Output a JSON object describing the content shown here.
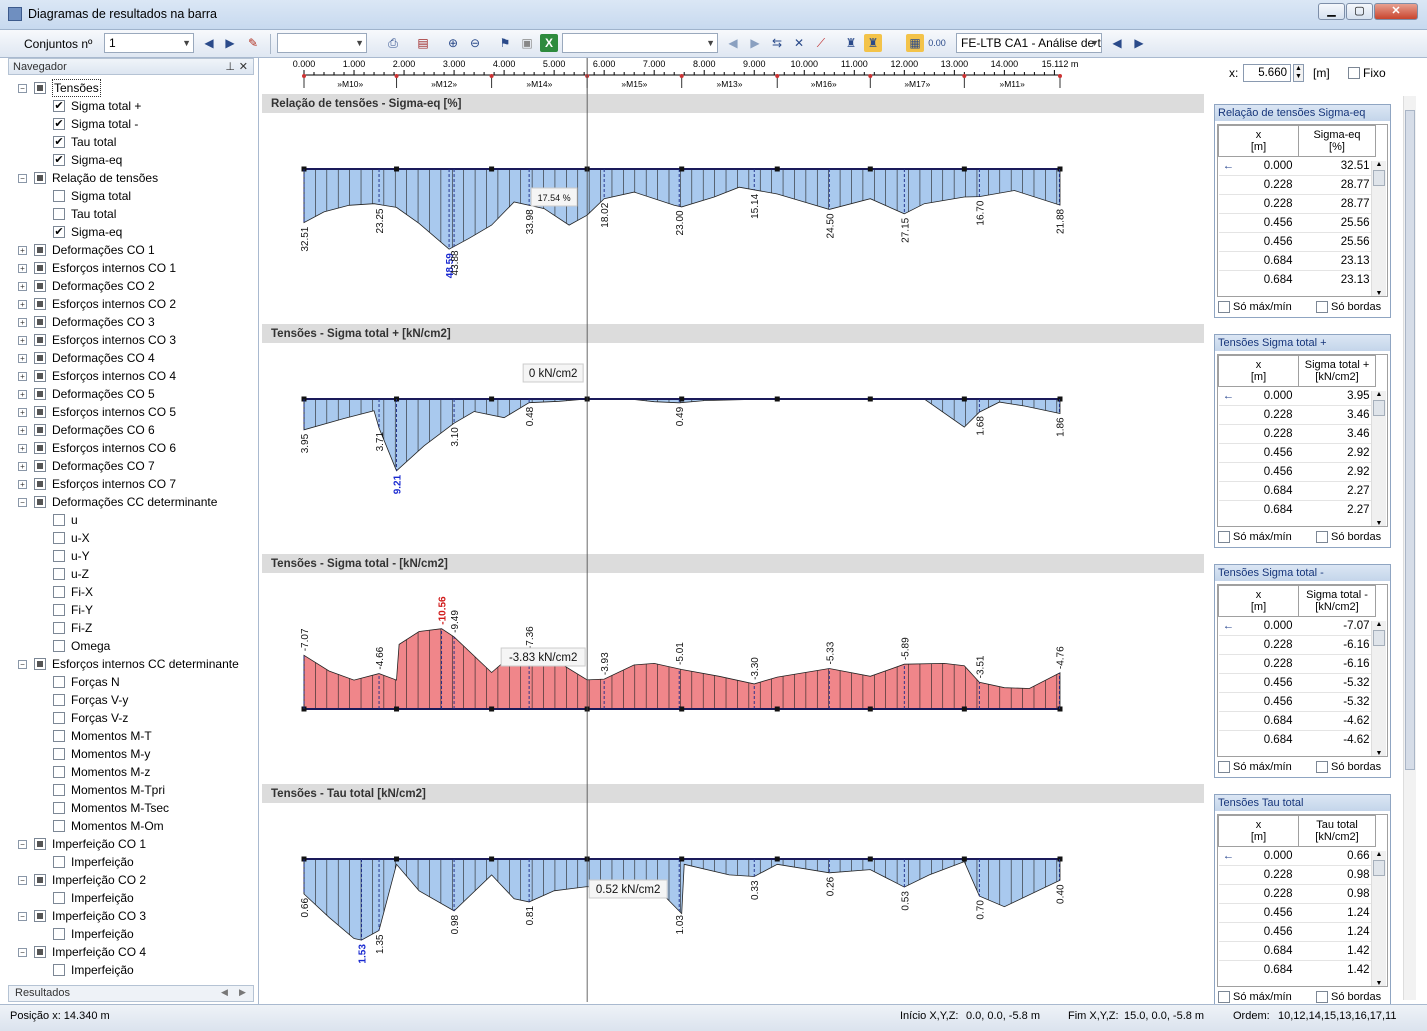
{
  "window": {
    "title": "Diagramas de resultados na barra"
  },
  "toolbar": {
    "conjuntos_label": "Conjuntos nº",
    "conjuntos_value": "1",
    "case_combo": "FE-LTB CA1 - Análise de t"
  },
  "navigator": {
    "title": "Navegador",
    "footer_tab": "Resultados",
    "items": [
      {
        "label": "Tensões",
        "level": 0,
        "exp": "-",
        "state": "part"
      },
      {
        "label": "Sigma total +",
        "level": 1,
        "state": "checked"
      },
      {
        "label": "Sigma total -",
        "level": 1,
        "state": "checked"
      },
      {
        "label": "Tau total",
        "level": 1,
        "state": "checked"
      },
      {
        "label": "Sigma-eq",
        "level": 1,
        "state": "checked"
      },
      {
        "label": "Relação de tensões",
        "level": 0,
        "exp": "-",
        "state": "part"
      },
      {
        "label": "Sigma total",
        "level": 1,
        "state": "empty"
      },
      {
        "label": "Tau total",
        "level": 1,
        "state": "empty"
      },
      {
        "label": "Sigma-eq",
        "level": 1,
        "state": "checked"
      },
      {
        "label": "Deformações CO 1",
        "level": 0,
        "exp": "+",
        "state": "part"
      },
      {
        "label": "Esforços internos CO 1",
        "level": 0,
        "exp": "+",
        "state": "part"
      },
      {
        "label": "Deformações CO 2",
        "level": 0,
        "exp": "+",
        "state": "part"
      },
      {
        "label": "Esforços internos CO 2",
        "level": 0,
        "exp": "+",
        "state": "part"
      },
      {
        "label": "Deformações CO 3",
        "level": 0,
        "exp": "+",
        "state": "part"
      },
      {
        "label": "Esforços internos CO 3",
        "level": 0,
        "exp": "+",
        "state": "part"
      },
      {
        "label": "Deformações CO 4",
        "level": 0,
        "exp": "+",
        "state": "part"
      },
      {
        "label": "Esforços internos CO 4",
        "level": 0,
        "exp": "+",
        "state": "part"
      },
      {
        "label": "Deformações CO 5",
        "level": 0,
        "exp": "+",
        "state": "part"
      },
      {
        "label": "Esforços internos CO 5",
        "level": 0,
        "exp": "+",
        "state": "part"
      },
      {
        "label": "Deformações CO 6",
        "level": 0,
        "exp": "+",
        "state": "part"
      },
      {
        "label": "Esforços internos CO 6",
        "level": 0,
        "exp": "+",
        "state": "part"
      },
      {
        "label": "Deformações CO 7",
        "level": 0,
        "exp": "+",
        "state": "part"
      },
      {
        "label": "Esforços internos CO 7",
        "level": 0,
        "exp": "+",
        "state": "part"
      },
      {
        "label": "Deformações CC determinante",
        "level": 0,
        "exp": "-",
        "state": "part"
      },
      {
        "label": "u",
        "level": 1,
        "state": "empty"
      },
      {
        "label": "u-X",
        "level": 1,
        "state": "empty"
      },
      {
        "label": "u-Y",
        "level": 1,
        "state": "empty"
      },
      {
        "label": "u-Z",
        "level": 1,
        "state": "empty"
      },
      {
        "label": "Fi-X",
        "level": 1,
        "state": "empty"
      },
      {
        "label": "Fi-Y",
        "level": 1,
        "state": "empty"
      },
      {
        "label": "Fi-Z",
        "level": 1,
        "state": "empty"
      },
      {
        "label": "Omega",
        "level": 1,
        "state": "empty"
      },
      {
        "label": "Esforços internos CC determinante",
        "level": 0,
        "exp": "-",
        "state": "part"
      },
      {
        "label": "Forças N",
        "level": 1,
        "state": "empty"
      },
      {
        "label": "Forças V-y",
        "level": 1,
        "state": "empty"
      },
      {
        "label": "Forças V-z",
        "level": 1,
        "state": "empty"
      },
      {
        "label": "Momentos M-T",
        "level": 1,
        "state": "empty"
      },
      {
        "label": "Momentos M-y",
        "level": 1,
        "state": "empty"
      },
      {
        "label": "Momentos M-z",
        "level": 1,
        "state": "empty"
      },
      {
        "label": "Momentos M-Tpri",
        "level": 1,
        "state": "empty"
      },
      {
        "label": "Momentos M-Tsec",
        "level": 1,
        "state": "empty"
      },
      {
        "label": "Momentos M-Om",
        "level": 1,
        "state": "empty"
      },
      {
        "label": "Imperfeição CO 1",
        "level": 0,
        "exp": "-",
        "state": "part"
      },
      {
        "label": "Imperfeição",
        "level": 1,
        "state": "empty"
      },
      {
        "label": "Imperfeição CO 2",
        "level": 0,
        "exp": "-",
        "state": "part"
      },
      {
        "label": "Imperfeição",
        "level": 1,
        "state": "empty"
      },
      {
        "label": "Imperfeição CO 3",
        "level": 0,
        "exp": "-",
        "state": "part"
      },
      {
        "label": "Imperfeição",
        "level": 1,
        "state": "empty"
      },
      {
        "label": "Imperfeição CO 4",
        "level": 0,
        "exp": "-",
        "state": "part"
      },
      {
        "label": "Imperfeição",
        "level": 1,
        "state": "empty"
      }
    ]
  },
  "ruler": {
    "ticks": [
      "0.000",
      "1.000",
      "2.000",
      "3.000",
      "4.000",
      "5.000",
      "6.000",
      "7.000",
      "8.000",
      "9.000",
      "10.000",
      "11.000",
      "12.000",
      "13.000",
      "14.000",
      "15.112 m"
    ],
    "members": [
      "»M10»",
      "»M12»",
      "»M14»",
      "»M15»",
      "»M13»",
      "»M16»",
      "»M17»",
      "»M11»"
    ]
  },
  "xcontrol": {
    "label": "x:",
    "value": "5.660",
    "unit": "[m]",
    "fixo": "Fixo"
  },
  "colors": {
    "blue_fill": "#a9c9ee",
    "red_fill": "#f0868a",
    "outline": "#1a1a5a"
  },
  "chart_data": [
    {
      "type": "area",
      "title": "Relação de tensões - Sigma-eq [%]",
      "cursor_label": "17.54 %",
      "labels": [
        {
          "x": 0.0,
          "v": "32.51"
        },
        {
          "x": 1.5,
          "v": "23.25"
        },
        {
          "x": 2.9,
          "v": "48.59",
          "hl": "max"
        },
        {
          "x": 3.0,
          "v": "43.88"
        },
        {
          "x": 4.5,
          "v": "33.98"
        },
        {
          "x": 6.0,
          "v": "18.02"
        },
        {
          "x": 7.5,
          "v": "23.00"
        },
        {
          "x": 9.0,
          "v": "15.14"
        },
        {
          "x": 10.5,
          "v": "24.50"
        },
        {
          "x": 12.0,
          "v": "27.15"
        },
        {
          "x": 13.5,
          "v": "16.70"
        },
        {
          "x": 15.1,
          "v": "21.88"
        }
      ]
    },
    {
      "type": "area",
      "title": "Tensões - Sigma total + [kN/cm2]",
      "cursor_label": "0 kN/cm2",
      "labels": [
        {
          "x": 0.0,
          "v": "3.95"
        },
        {
          "x": 1.5,
          "v": "3.71"
        },
        {
          "x": 1.85,
          "v": "9.21",
          "hl": "max"
        },
        {
          "x": 3.0,
          "v": "3.10"
        },
        {
          "x": 4.5,
          "v": "0.48"
        },
        {
          "x": 7.5,
          "v": "0.49"
        },
        {
          "x": 13.5,
          "v": "1.68"
        },
        {
          "x": 15.1,
          "v": "1.86"
        }
      ]
    },
    {
      "type": "area",
      "title": "Tensões - Sigma total - [kN/cm2]",
      "cursor_label": "-3.83 kN/cm2",
      "labels": [
        {
          "x": 0.0,
          "v": "-7.07"
        },
        {
          "x": 1.5,
          "v": "-4.66"
        },
        {
          "x": 2.75,
          "v": "-10.56",
          "hl": "min"
        },
        {
          "x": 3.0,
          "v": "-9.49"
        },
        {
          "x": 4.5,
          "v": "-7.36"
        },
        {
          "x": 6.0,
          "v": "-3.93"
        },
        {
          "x": 7.5,
          "v": "-5.01"
        },
        {
          "x": 9.0,
          "v": "-3.30"
        },
        {
          "x": 10.5,
          "v": "-5.33"
        },
        {
          "x": 12.0,
          "v": "-5.89"
        },
        {
          "x": 13.5,
          "v": "-3.51"
        },
        {
          "x": 15.1,
          "v": "-4.76"
        }
      ]
    },
    {
      "type": "area",
      "title": "Tensões - Tau total [kN/cm2]",
      "cursor_label": "0.52 kN/cm2",
      "labels": [
        {
          "x": 0.0,
          "v": "0.66"
        },
        {
          "x": 1.15,
          "v": "1.53",
          "hl": "max"
        },
        {
          "x": 1.5,
          "v": "1.35"
        },
        {
          "x": 3.0,
          "v": "0.98"
        },
        {
          "x": 4.5,
          "v": "0.81"
        },
        {
          "x": 7.5,
          "v": "1.03"
        },
        {
          "x": 9.0,
          "v": "0.33"
        },
        {
          "x": 10.5,
          "v": "0.26"
        },
        {
          "x": 12.0,
          "v": "0.53"
        },
        {
          "x": 13.5,
          "v": "0.70"
        },
        {
          "x": 15.1,
          "v": "0.40"
        }
      ]
    }
  ],
  "panels": [
    {
      "title": "Relação de tensões Sigma-eq",
      "col1": "x",
      "col1u": "[m]",
      "col2": "Sigma-eq",
      "col2u": "[%]",
      "rows": [
        [
          "0.000",
          "32.51"
        ],
        [
          "0.228",
          "28.77"
        ],
        [
          "0.228",
          "28.77"
        ],
        [
          "0.456",
          "25.56"
        ],
        [
          "0.456",
          "25.56"
        ],
        [
          "0.684",
          "23.13"
        ],
        [
          "0.684",
          "23.13"
        ]
      ]
    },
    {
      "title": "Tensões Sigma total +",
      "col1": "x",
      "col1u": "[m]",
      "col2": "Sigma total +",
      "col2u": "[kN/cm2]",
      "rows": [
        [
          "0.000",
          "3.95"
        ],
        [
          "0.228",
          "3.46"
        ],
        [
          "0.228",
          "3.46"
        ],
        [
          "0.456",
          "2.92"
        ],
        [
          "0.456",
          "2.92"
        ],
        [
          "0.684",
          "2.27"
        ],
        [
          "0.684",
          "2.27"
        ]
      ]
    },
    {
      "title": "Tensões Sigma total -",
      "col1": "x",
      "col1u": "[m]",
      "col2": "Sigma total -",
      "col2u": "[kN/cm2]",
      "rows": [
        [
          "0.000",
          "-7.07"
        ],
        [
          "0.228",
          "-6.16"
        ],
        [
          "0.228",
          "-6.16"
        ],
        [
          "0.456",
          "-5.32"
        ],
        [
          "0.456",
          "-5.32"
        ],
        [
          "0.684",
          "-4.62"
        ],
        [
          "0.684",
          "-4.62"
        ]
      ]
    },
    {
      "title": "Tensões Tau total",
      "col1": "x",
      "col1u": "[m]",
      "col2": "Tau total",
      "col2u": "[kN/cm2]",
      "rows": [
        [
          "0.000",
          "0.66"
        ],
        [
          "0.228",
          "0.98"
        ],
        [
          "0.228",
          "0.98"
        ],
        [
          "0.456",
          "1.24"
        ],
        [
          "0.456",
          "1.24"
        ],
        [
          "0.684",
          "1.42"
        ],
        [
          "0.684",
          "1.42"
        ]
      ]
    }
  ],
  "panel_footer": {
    "maxmin": "Só máx/mín",
    "bordas": "Só bordas"
  },
  "status": {
    "posicao": "Posição x: 14.340 m",
    "inicio_label": "Início X,Y,Z:",
    "inicio": "0.0, 0.0, -5.8 m",
    "fim_label": "Fim X,Y,Z:",
    "fim": "15.0, 0.0, -5.8 m",
    "ordem_label": "Ordem:",
    "ordem": "10,12,14,15,13,16,17,11"
  }
}
